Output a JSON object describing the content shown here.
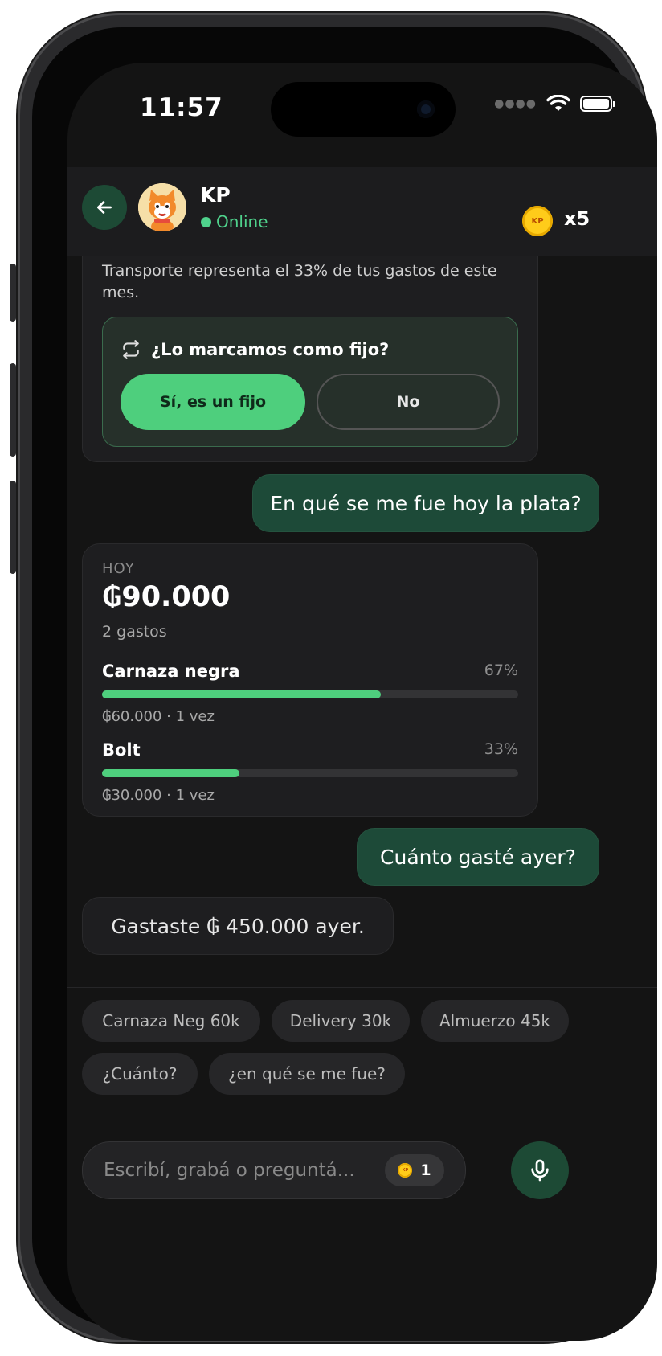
{
  "status_bar": {
    "time": "11:57"
  },
  "header": {
    "name": "KP",
    "status": "Online",
    "coin_text": "KP",
    "coin_count": "x5"
  },
  "messages": {
    "insight_text": "Transporte representa el 33% de tus gastos de este mes.",
    "question": {
      "title": "¿Lo marcamos como fijo?",
      "yes_label": "Sí, es un fijo",
      "no_label": "No"
    },
    "user_1": "En qué se me fue hoy la plata?",
    "summary": {
      "label": "HOY",
      "total": "₲90.000",
      "count": "2 gastos",
      "items": [
        {
          "name": "Carnaza negra",
          "percent": "67%",
          "share": 0.67,
          "meta": "₲60.000 · 1 vez"
        },
        {
          "name": "Bolt",
          "percent": "33%",
          "share": 0.33,
          "meta": "₲30.000 · 1 vez"
        }
      ]
    },
    "user_2": "Cuánto gasté ayer?",
    "bot_reply": "Gastaste ₲ 450.000 ayer."
  },
  "suggestions": [
    "Carnaza Neg 60k",
    "Delivery 30k",
    "Almuerzo 45k",
    "¿Cuánto?",
    "¿en qué se me fue?"
  ],
  "composer": {
    "placeholder": "Escribí, grabá o preguntá...",
    "credit_coin_text": "KP",
    "credits": "1"
  },
  "colors": {
    "accent": "#4ecf7d",
    "user_bubble": "#1d4a38",
    "background": "#141414"
  }
}
